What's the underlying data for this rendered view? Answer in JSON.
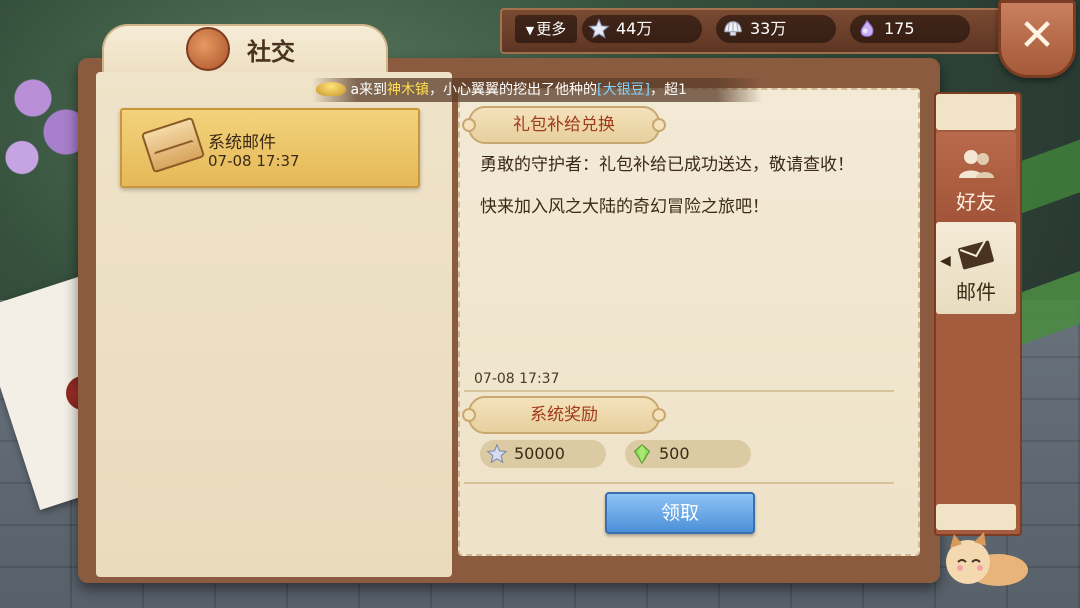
{
  "window": {
    "title": "社交"
  },
  "ticker": {
    "part1": "a来到",
    "place": "神木镇",
    "part2": "，小心翼翼的挖出了他种的",
    "item": "[大银豆]",
    "part3": "，超1"
  },
  "currency": {
    "more_label": "更多",
    "items": [
      {
        "icon": "star-icon",
        "value": "44万"
      },
      {
        "icon": "shell-icon",
        "value": "33万"
      },
      {
        "icon": "pearl-icon",
        "value": "175"
      }
    ]
  },
  "mail_list": [
    {
      "title": "系统邮件",
      "time": "07-08 17:37"
    }
  ],
  "message": {
    "header": "礼包补给兑换",
    "lines": [
      "勇敢的守护者：礼包补给已成功送达，敬请查收！",
      "快来加入风之大陆的奇幻冒险之旅吧！"
    ],
    "time": "07-08 17:37",
    "reward_header": "系统奖励",
    "rewards": [
      {
        "icon": "silver-star-icon",
        "value": "50000"
      },
      {
        "icon": "green-gem-icon",
        "value": "500"
      }
    ],
    "claim_label": "领取"
  },
  "side_tabs": [
    {
      "label": "好友",
      "icon": "friends-icon",
      "active": false
    },
    {
      "label": "邮件",
      "icon": "envelope-icon",
      "active": true
    }
  ],
  "colors": {
    "frame": "#8b5b3f",
    "page": "#efe3c9",
    "highlight": "#f3d27c",
    "accent_red": "#a13a1c",
    "claim_blue": "#4c8fd8"
  }
}
